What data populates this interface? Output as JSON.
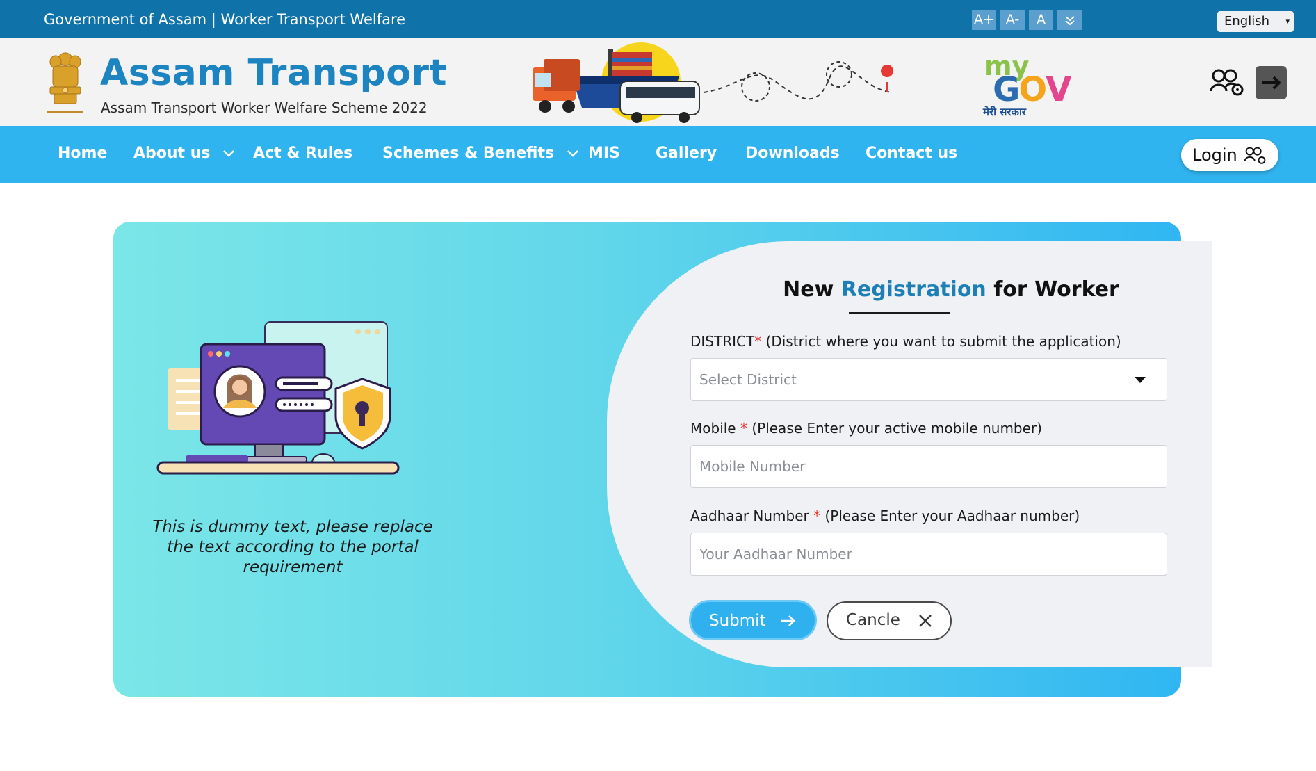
{
  "topbar": {
    "title": "Government of Assam | Worker Transport  Welfare",
    "font_controls": [
      "A+",
      "A-",
      "A"
    ],
    "language": "English"
  },
  "header": {
    "brand_title": "Assam Transport",
    "brand_subtitle": "Assam Transport Worker Welfare Scheme 2022",
    "mygov_tagline": "मेरी सरकार"
  },
  "nav": {
    "items": [
      "Home",
      "About us",
      "Act & Rules",
      "Schemes & Benefits",
      "MIS",
      "Gallery",
      "Downloads",
      "Contact us"
    ],
    "login_label": "Login"
  },
  "left": {
    "dummy_text_1": "This is dummy text, please replace",
    "dummy_text_2": "the text according to the portal",
    "dummy_text_3": "requirement"
  },
  "form": {
    "title_pre": "New ",
    "title_highlight": "Registration",
    "title_post": " for Worker",
    "district_label": "DISTRICT",
    "district_hint": " (District where you want to submit the application)",
    "district_placeholder": "Select District",
    "mobile_label": "Mobile ",
    "mobile_hint": " (Please Enter your active mobile number)",
    "mobile_placeholder": "Mobile Number",
    "aadhaar_label": "Aadhaar Number ",
    "aadhaar_hint": " (Please Enter your Aadhaar number)",
    "aadhaar_placeholder": "Your Aadhaar Number",
    "required_mark": "*",
    "submit_label": "Submit",
    "cancel_label": "Cancle"
  },
  "colors": {
    "topbar": "#0f72a8",
    "nav": "#30b4f0",
    "brand": "#1d84c2",
    "required": "#e53935"
  }
}
